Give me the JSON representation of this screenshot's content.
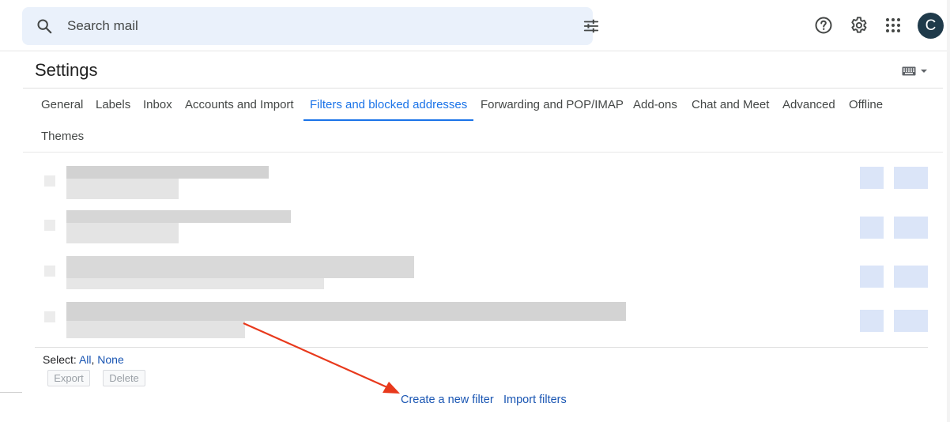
{
  "search": {
    "placeholder": "Search mail"
  },
  "settings": {
    "title": "Settings"
  },
  "tabs": [
    {
      "label": "General"
    },
    {
      "label": "Labels"
    },
    {
      "label": "Inbox"
    },
    {
      "label": "Accounts and Import"
    },
    {
      "label": "Filters and blocked addresses"
    },
    {
      "label": "Forwarding and POP/IMAP"
    },
    {
      "label": "Add-ons"
    },
    {
      "label": "Chat and Meet"
    },
    {
      "label": "Advanced"
    },
    {
      "label": "Offline"
    },
    {
      "label": "Themes"
    }
  ],
  "active_tab": "Filters and blocked addresses",
  "avatar": {
    "initial": "C"
  },
  "select": {
    "prefix": "Select:",
    "all": "All",
    "separator": ",",
    "none": "None"
  },
  "buttons": {
    "export": "Export",
    "delete": "Delete"
  },
  "links": {
    "create_filter": "Create a new filter",
    "import_filters": "Import filters"
  },
  "icons": [
    "search-icon",
    "tune-icon",
    "help-icon",
    "gear-icon",
    "apps-grid-icon",
    "keyboard-icon"
  ],
  "colors": {
    "accent": "#1a73e8",
    "link": "#1a56b3",
    "arrow": "#e8391c",
    "search_bg": "#eaf1fb"
  }
}
